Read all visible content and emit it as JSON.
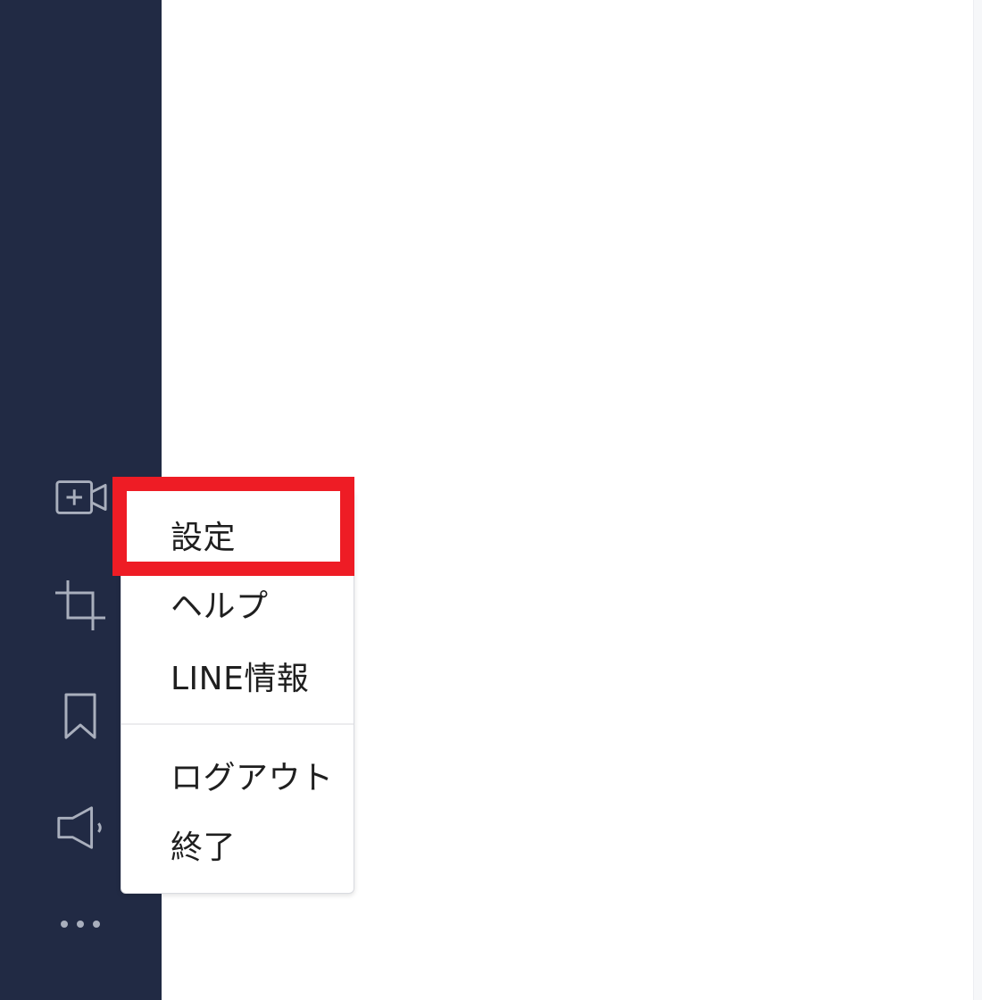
{
  "sidebar": {
    "icons": [
      {
        "name": "add-video-call-icon"
      },
      {
        "name": "crop-icon"
      },
      {
        "name": "bookmark-icon"
      },
      {
        "name": "speaker-icon"
      },
      {
        "name": "more-icon"
      }
    ]
  },
  "menu": {
    "items": [
      {
        "label": "設定"
      },
      {
        "label": "ヘルプ"
      },
      {
        "label": "LINE情報"
      },
      {
        "label": "ログアウト"
      },
      {
        "label": "終了"
      }
    ]
  },
  "colors": {
    "sidebar_bg": "#212a44",
    "icon_stroke": "#a9afbd",
    "highlight": "#ee1c25"
  }
}
